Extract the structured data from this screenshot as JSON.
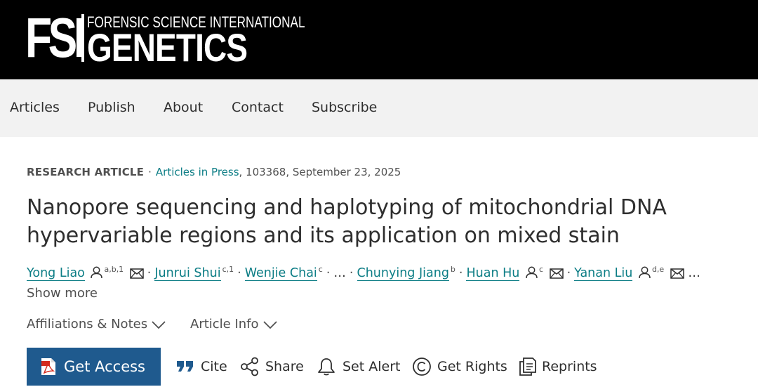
{
  "header": {
    "logo_abbrev": "FSI",
    "logo_top": "FORENSIC SCIENCE INTERNATIONAL",
    "logo_main": "GENETICS"
  },
  "nav": {
    "items": [
      "Articles",
      "Publish",
      "About",
      "Contact",
      "Subscribe"
    ]
  },
  "article": {
    "type": "RESEARCH ARTICLE",
    "dot": "·",
    "journal_status": "Articles in Press",
    "meta_rest": ", 103368, September 23, 2025",
    "title": "Nanopore sequencing and haplotyping of mitochondrial DNA hypervariable regions and its application on mixed stain",
    "authors": [
      {
        "name": "Yong Liao",
        "aff": "a,b,1"
      },
      {
        "name": "Junrui Shui",
        "aff": "c,1"
      },
      {
        "name": "Wenjie Chai",
        "aff": "c"
      },
      {
        "name": "Chunying Jiang",
        "aff": "b"
      },
      {
        "name": "Huan Hu",
        "aff": "c"
      },
      {
        "name": "Yanan Liu",
        "aff": "d,e"
      }
    ],
    "ellipsis": "…",
    "separator": "·",
    "show_more": "Show more",
    "affiliations_label": "Affiliations & Notes",
    "article_info_label": "Article Info"
  },
  "actions": {
    "get_access": "Get Access",
    "cite": "Cite",
    "share": "Share",
    "set_alert": "Set Alert",
    "get_rights": "Get Rights",
    "reprints": "Reprints"
  },
  "colors": {
    "header_bg": "#000000",
    "nav_bg": "#f2f2f2",
    "link": "#0c7d85",
    "primary_button": "#1f5a8e",
    "text": "#2e2e2e"
  }
}
